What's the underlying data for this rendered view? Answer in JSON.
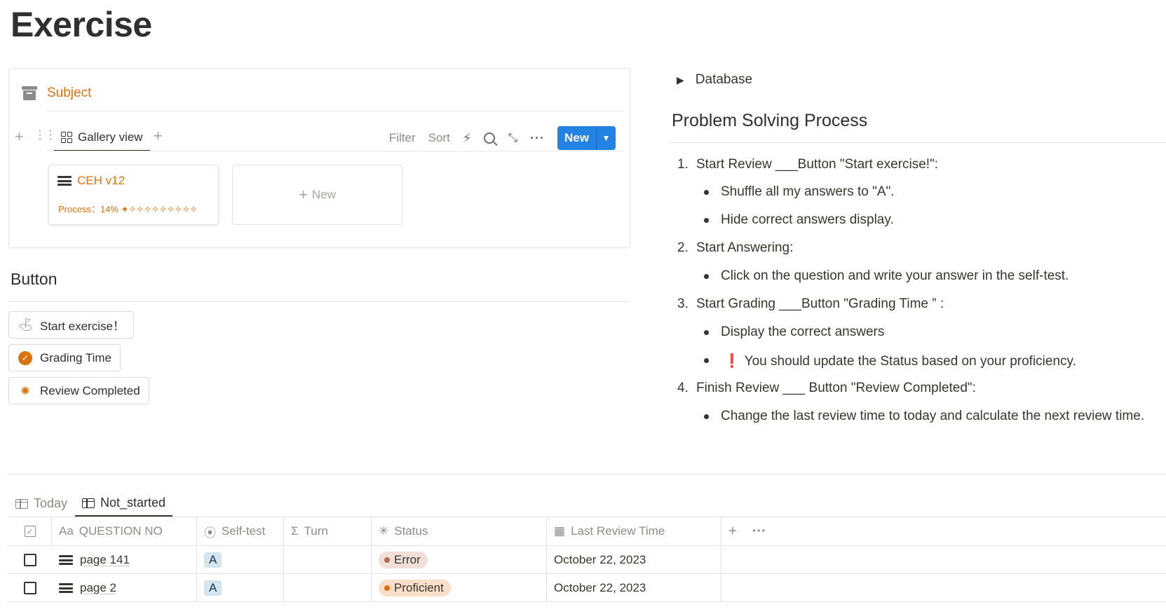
{
  "page": {
    "title": "Exercise"
  },
  "database": {
    "title": "Subject",
    "view_tab": "Gallery view",
    "tools": {
      "filter": "Filter",
      "sort": "Sort",
      "new": "New"
    },
    "cards": [
      {
        "title": "CEH v12",
        "progress": "Process：14% ✦✧✧✧✧✧✧✧✧✧"
      }
    ],
    "new_card": "New"
  },
  "button_section": {
    "heading": "Button",
    "buttons": [
      {
        "label": "Start exercise！",
        "icon": "flag-icon"
      },
      {
        "label": "Grading Time",
        "icon": "check-circle-icon"
      },
      {
        "label": "Review Completed",
        "icon": "party-icon"
      }
    ]
  },
  "right": {
    "toggle": "Database",
    "heading": "Problem Solving Process",
    "steps": [
      {
        "num": "1.",
        "text": "Start Review ___Button \"Start exercise!\":",
        "bullets": [
          "Shuffle all my answers to \"A\".",
          "Hide correct answers display."
        ]
      },
      {
        "num": "2.",
        "text": "Start Answering:",
        "bullets": [
          "Click on the question and write your answer in the self-test."
        ]
      },
      {
        "num": "3.",
        "text": "Start Grading ___Button \"Grading Time ” :",
        "bullets": [
          "Display the correct answers",
          "You should update the Status based on your proficiency."
        ]
      },
      {
        "num": "4.",
        "text": "Finish Review ___ Button \"Review Completed\":",
        "bullets": [
          "Change the last review time to today and calculate the next review time."
        ]
      }
    ],
    "exclamation": "❗"
  },
  "table": {
    "tabs": [
      "Today",
      "Not_started"
    ],
    "columns": [
      "QUESTION NO",
      "Self-test",
      "Turn",
      "Status",
      "Last Review Time"
    ],
    "column_prefix": {
      "question": "Aa",
      "turn": "Σ"
    },
    "rows": [
      {
        "question": "page 141",
        "self_test": "A",
        "turn": "",
        "status": "Error",
        "status_bg": "#f2dfd9",
        "status_dot": "#b06a5a",
        "last_review": "October 22, 2023"
      },
      {
        "question": "page 2",
        "self_test": "A",
        "turn": "",
        "status": "Proficient",
        "status_bg": "#fadec9",
        "status_dot": "#d9730d",
        "last_review": "October 22, 2023"
      }
    ]
  },
  "colors": {
    "accent": "#d9730d",
    "primary_button": "#2383e2"
  }
}
